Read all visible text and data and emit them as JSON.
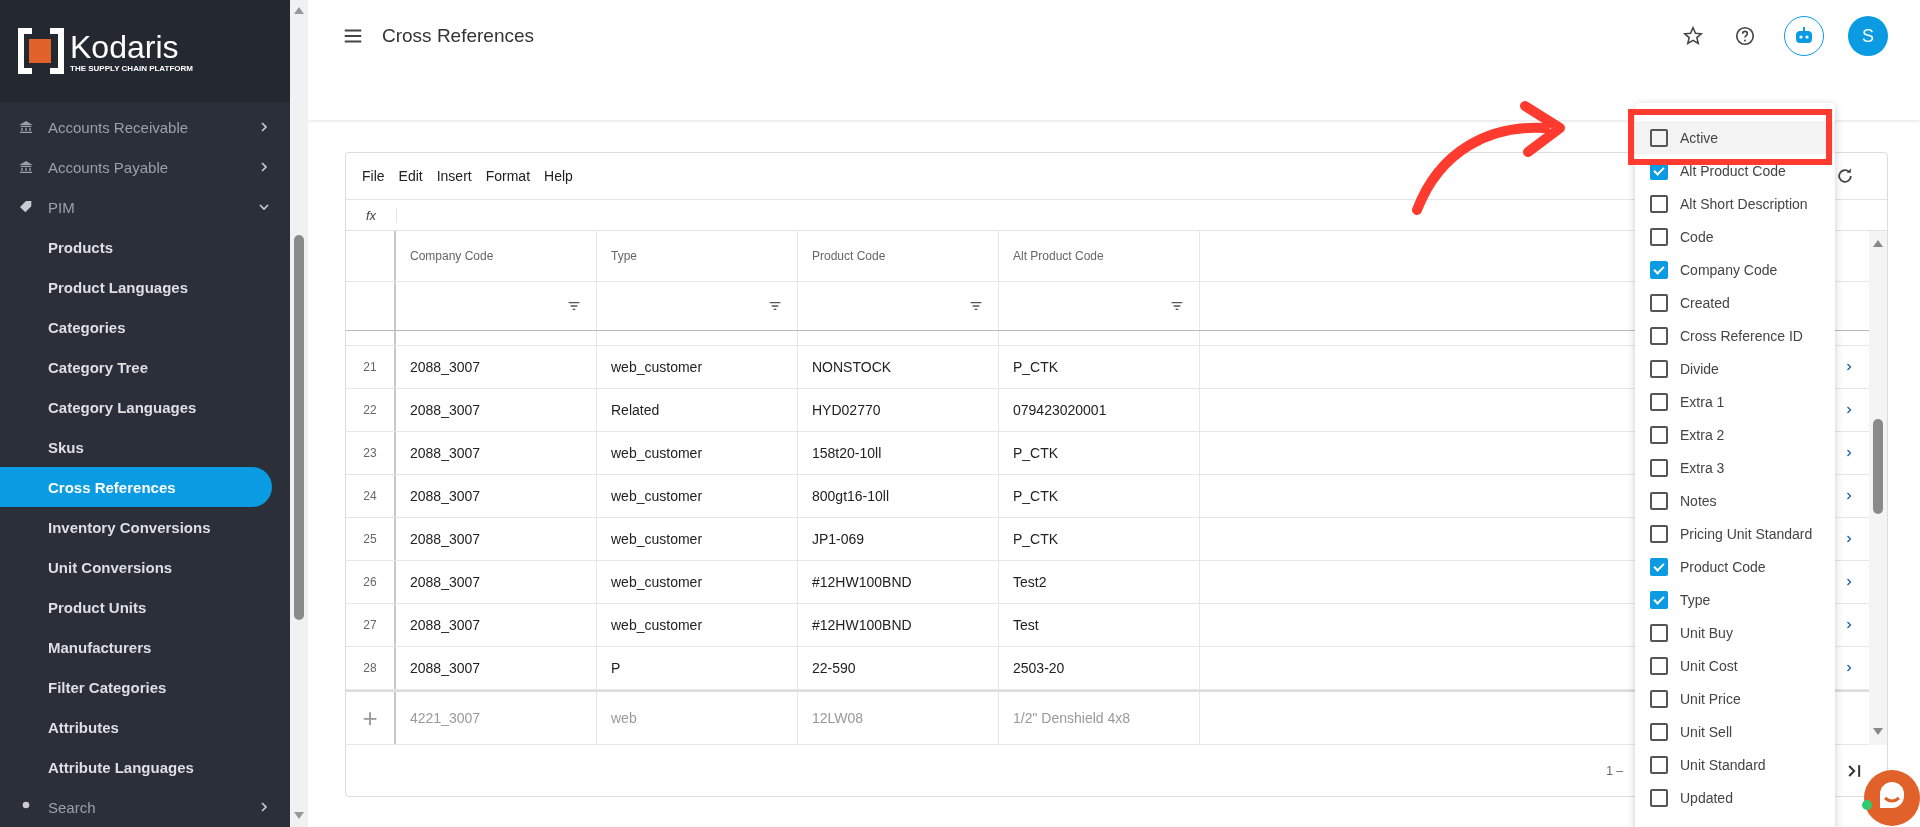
{
  "sidebar": {
    "logo": {
      "name": "Kodaris",
      "tagline": "THE SUPPLY CHAIN PLATFORM"
    },
    "items": [
      {
        "label": "Accounts Receivable",
        "expanded": false
      },
      {
        "label": "Accounts Payable",
        "expanded": false
      },
      {
        "label": "PIM",
        "expanded": true,
        "children": [
          {
            "label": "Products",
            "selected": false
          },
          {
            "label": "Product Languages",
            "selected": false
          },
          {
            "label": "Categories",
            "selected": false
          },
          {
            "label": "Category Tree",
            "selected": false
          },
          {
            "label": "Category Languages",
            "selected": false
          },
          {
            "label": "Skus",
            "selected": false
          },
          {
            "label": "Cross References",
            "selected": true
          },
          {
            "label": "Inventory Conversions",
            "selected": false
          },
          {
            "label": "Unit Conversions",
            "selected": false
          },
          {
            "label": "Product Units",
            "selected": false
          },
          {
            "label": "Manufacturers",
            "selected": false
          },
          {
            "label": "Filter Categories",
            "selected": false
          },
          {
            "label": "Attributes",
            "selected": false
          },
          {
            "label": "Attribute Languages",
            "selected": false
          }
        ]
      },
      {
        "label": "Search",
        "expanded": false
      }
    ]
  },
  "header": {
    "title": "Cross References",
    "avatar": "S"
  },
  "grid": {
    "menu": [
      "File",
      "Edit",
      "Insert",
      "Format",
      "Help"
    ],
    "formula_label": "fx",
    "columns": [
      "Company Code",
      "Type",
      "Product Code",
      "Alt Product Code"
    ],
    "rows": [
      {
        "number": "21",
        "cells": [
          "2088_3007",
          "web_customer",
          "NONSTOCK",
          "P_CTK"
        ]
      },
      {
        "number": "22",
        "cells": [
          "2088_3007",
          "Related",
          "HYD02770",
          "079423020001"
        ]
      },
      {
        "number": "23",
        "cells": [
          "2088_3007",
          "web_customer",
          "158t20-10ll",
          "P_CTK"
        ]
      },
      {
        "number": "24",
        "cells": [
          "2088_3007",
          "web_customer",
          "800gt16-10ll",
          "P_CTK"
        ]
      },
      {
        "number": "25",
        "cells": [
          "2088_3007",
          "web_customer",
          "JP1-069",
          "P_CTK"
        ]
      },
      {
        "number": "26",
        "cells": [
          "2088_3007",
          "web_customer",
          "#12HW100BND",
          "Test2"
        ]
      },
      {
        "number": "27",
        "cells": [
          "2088_3007",
          "web_customer",
          "#12HW100BND",
          "Test"
        ]
      },
      {
        "number": "28",
        "cells": [
          "2088_3007",
          "P",
          "22-590",
          "2503-20"
        ]
      }
    ],
    "new_row": {
      "add": "+",
      "cells": [
        "4221_3007",
        "web",
        "12LW08",
        "1/2\" Denshield 4x8"
      ]
    },
    "pagination": "1 –"
  },
  "column_chooser": [
    {
      "label": "Active",
      "checked": false,
      "highlighted": true
    },
    {
      "label": "Alt Product Code",
      "checked": true,
      "highlighted": false
    },
    {
      "label": "Alt Short Description",
      "checked": false,
      "highlighted": false
    },
    {
      "label": "Code",
      "checked": false,
      "highlighted": false
    },
    {
      "label": "Company Code",
      "checked": true,
      "highlighted": false
    },
    {
      "label": "Created",
      "checked": false,
      "highlighted": false
    },
    {
      "label": "Cross Reference ID",
      "checked": false,
      "highlighted": false
    },
    {
      "label": "Divide",
      "checked": false,
      "highlighted": false
    },
    {
      "label": "Extra 1",
      "checked": false,
      "highlighted": false
    },
    {
      "label": "Extra 2",
      "checked": false,
      "highlighted": false
    },
    {
      "label": "Extra 3",
      "checked": false,
      "highlighted": false
    },
    {
      "label": "Notes",
      "checked": false,
      "highlighted": false
    },
    {
      "label": "Pricing Unit Standard",
      "checked": false,
      "highlighted": false
    },
    {
      "label": "Product Code",
      "checked": true,
      "highlighted": false
    },
    {
      "label": "Type",
      "checked": true,
      "highlighted": false
    },
    {
      "label": "Unit Buy",
      "checked": false,
      "highlighted": false
    },
    {
      "label": "Unit Cost",
      "checked": false,
      "highlighted": false
    },
    {
      "label": "Unit Price",
      "checked": false,
      "highlighted": false
    },
    {
      "label": "Unit Sell",
      "checked": false,
      "highlighted": false
    },
    {
      "label": "Unit Standard",
      "checked": false,
      "highlighted": false
    },
    {
      "label": "Updated",
      "checked": false,
      "highlighted": false
    }
  ]
}
